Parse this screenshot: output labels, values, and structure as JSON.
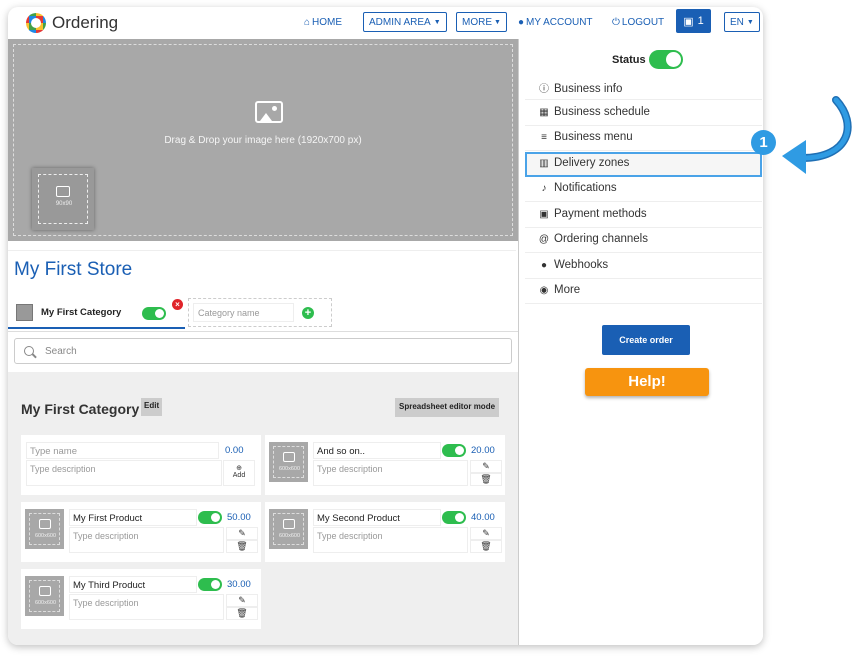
{
  "header": {
    "logo_text": "Ordering",
    "home": "HOME",
    "admin_area": "ADMIN AREA",
    "more": "MORE",
    "my_account": "MY ACCOUNT",
    "logout": "LOGOUT",
    "cart_count": "1",
    "language": "EN"
  },
  "hero": {
    "drop_text": "Drag & Drop your image here (1920x700 px)",
    "logo_size": "90x90"
  },
  "store": {
    "title": "My First Store"
  },
  "categories": {
    "active": "My First Category",
    "new_placeholder": "Category name"
  },
  "search": {
    "placeholder": "Search"
  },
  "product_list": {
    "heading": "My First Category",
    "edit": "Edit",
    "spreadsheet": "Spreadsheet editor mode",
    "new_name_placeholder": "Type name",
    "new_price": "0.00",
    "new_desc_placeholder": "Type description",
    "add": "Add",
    "image_size": "600x600",
    "items": [
      {
        "name": "And so on..",
        "price": "20.00",
        "desc": "Type description"
      },
      {
        "name": "My First Product",
        "price": "50.00",
        "desc": "Type description"
      },
      {
        "name": "My Second Product",
        "price": "40.00",
        "desc": "Type description"
      },
      {
        "name": "My Third Product",
        "price": "30.00",
        "desc": "Type description"
      }
    ]
  },
  "sidebar": {
    "status_label": "Status",
    "items": [
      {
        "label": "Business info",
        "icon": "info-icon"
      },
      {
        "label": "Business schedule",
        "icon": "calendar-icon"
      },
      {
        "label": "Business menu",
        "icon": "menu-icon"
      },
      {
        "label": "Delivery zones",
        "icon": "map-icon"
      },
      {
        "label": "Notifications",
        "icon": "bell-icon"
      },
      {
        "label": "Payment methods",
        "icon": "money-icon"
      },
      {
        "label": "Ordering channels",
        "icon": "at-icon"
      },
      {
        "label": "Webhooks",
        "icon": "globe-icon"
      },
      {
        "label": "More",
        "icon": "more-icon"
      }
    ],
    "create_order": "Create order",
    "help": "Help!"
  },
  "callout": {
    "step": "1"
  },
  "colors": {
    "primary": "#1a5fb4",
    "toggle_on": "#2ebd4e",
    "help": "#f7940f",
    "callout": "#2f9be3"
  }
}
